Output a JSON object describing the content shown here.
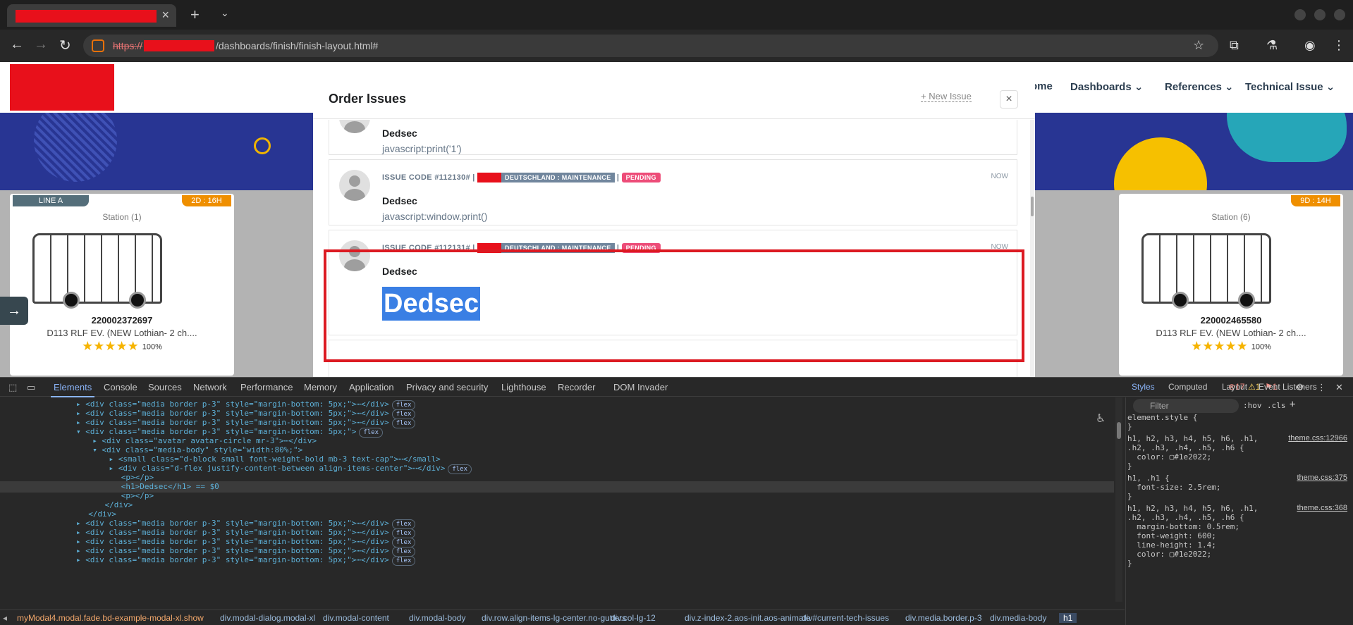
{
  "browser": {
    "tab_close": "×",
    "tab_new": "+",
    "tab_list": "⌄",
    "url_scheme": "https://",
    "url_path": "/dashboards/finish/finish-layout.html#"
  },
  "site": {
    "nav": [
      "ome",
      "Dashboards ⌄",
      "References ⌄",
      "Technical Issue ⌄"
    ]
  },
  "cards": [
    {
      "line": "LINE A",
      "time": "2D : 16H",
      "station": "Station (1)",
      "id": "220002372697",
      "desc": "D113 RLF EV. (NEW Lothian- 2 ch....",
      "stars": "★★★★★",
      "pct": "100%"
    },
    {
      "line": "",
      "time": "9D : 14H",
      "station": "Station (6)",
      "id": "220002465580",
      "desc": "D113 RLF EV. (NEW Lothian- 2 ch....",
      "stars": "★★★★★",
      "pct": "100%"
    }
  ],
  "modal": {
    "title": "Order Issues",
    "new_issue": "+ New Issue",
    "close": "×",
    "issues": [
      {
        "user": "Dedsec",
        "text": "javascript:print('1')"
      },
      {
        "code": "ISSUE CODE #112130# |",
        "dept": "DEUTSCHLAND : MAINTENANCE",
        "status": "PENDING",
        "time": "NOW",
        "user": "Dedsec",
        "text": "javascript:window.print()"
      },
      {
        "code": "ISSUE CODE #112131# |",
        "dept": "DEUTSCHLAND : MAINTENANCE",
        "status": "PENDING",
        "time": "NOW",
        "user": "Dedsec",
        "h1": "Dedsec"
      }
    ]
  },
  "devtools": {
    "tabs": [
      "Elements",
      "Console",
      "Sources",
      "Network",
      "Performance",
      "Memory",
      "Application",
      "Privacy and security",
      "Lighthouse",
      "Recorder",
      "DOM Invader"
    ],
    "status": {
      "errors": "17",
      "warnings": "1",
      "issues": "1"
    },
    "styles_tabs": [
      "Styles",
      "Computed",
      "Layout",
      "Event Listeners"
    ],
    "filter_placeholder": "Filter",
    "hov": ":hov",
    "cls": ".cls",
    "styles": [
      {
        "text": "element.style {"
      },
      {
        "text": "}"
      },
      {
        "text": "h1, h2, h3, h4, h5, h6, .h1,",
        "link": "theme.css:12966"
      },
      {
        "text": ".h2, .h3, .h4, .h5, .h6 {"
      },
      {
        "text": "  color: ▢#1e2022;"
      },
      {
        "text": "}"
      },
      {
        "text": "h1, .h1 {",
        "link": "theme.css:375"
      },
      {
        "text": "  font-size: 2.5rem;"
      },
      {
        "text": "}"
      },
      {
        "text": "h1, h2, h3, h4, h5, h6, .h1,",
        "link": "theme.css:368"
      },
      {
        "text": ".h2, .h3, .h4, .h5, .h6 {"
      },
      {
        "text": "  margin-bottom: 0.5rem;"
      },
      {
        "text": "  font-weight: 600;"
      },
      {
        "text": "  line-height: 1.4;"
      },
      {
        "text": "  color: ▢#1e2022;"
      },
      {
        "text": "}"
      }
    ],
    "dom": [
      "▸ <div class=\"media border p-3\" style=\"margin-bottom: 5px;\">⋯</div>",
      "▸ <div class=\"media border p-3\" style=\"margin-bottom: 5px;\">⋯</div>",
      "▸ <div class=\"media border p-3\" style=\"margin-bottom: 5px;\">⋯</div>",
      "▾ <div class=\"media border p-3\" style=\"margin-bottom: 5px;\">",
      "  ▸ <div class=\"avatar avatar-circle mr-3\">⋯</div>",
      "  ▾ <div class=\"media-body\" style=\"width:80%;\">",
      "    ▸ <small class=\"d-block small font-weight-bold mb-3 text-cap\">⋯</small>",
      "    ▸ <div class=\"d-flex justify-content-between align-items-center\">⋯</div>",
      "      <p></p>",
      "      <h1>Dedsec</h1> == $0",
      "      <p></p>",
      "    </div>",
      "  </div>",
      "▸ <div class=\"media border p-3\" style=\"margin-bottom: 5px;\">⋯</div>",
      "▸ <div class=\"media border p-3\" style=\"margin-bottom: 5px;\">⋯</div>",
      "▸ <div class=\"media border p-3\" style=\"margin-bottom: 5px;\">⋯</div>",
      "▸ <div class=\"media border p-3\" style=\"margin-bottom: 5px;\">⋯</div>",
      "▸ <div class=\"media border p-3\" style=\"margin-bottom: 5px;\">⋯</div>"
    ],
    "breadcrumbs": [
      "myModal4.modal.fade.bd-example-modal-xl.show",
      "div.modal-dialog.modal-xl",
      "div.modal-content",
      "div.modal-body",
      "div.row.align-items-lg-center.no-gutters",
      "div.col-lg-12",
      "div.z-index-2.aos-init.aos-animate",
      "div#current-tech-issues",
      "div.media.border.p-3",
      "div.media-body",
      "h1"
    ]
  }
}
